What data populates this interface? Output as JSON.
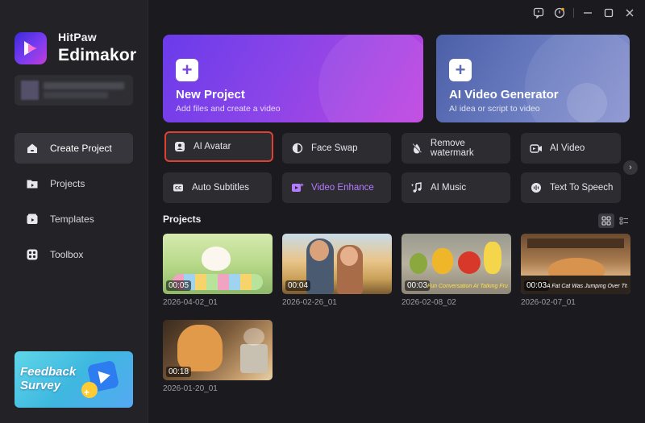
{
  "app": {
    "brand_top": "HitPaw",
    "brand_bottom": "Edimakor"
  },
  "sidebar": {
    "items": [
      {
        "label": "Create Project",
        "icon": "home-icon",
        "active": true
      },
      {
        "label": "Projects",
        "icon": "folder-icon",
        "active": false
      },
      {
        "label": "Templates",
        "icon": "templates-icon",
        "active": false
      },
      {
        "label": "Toolbox",
        "icon": "toolbox-icon",
        "active": false
      }
    ],
    "feedback_banner": "Feedback Survey"
  },
  "window_controls": [
    "feedback-icon",
    "update-icon",
    "minimize-icon",
    "maximize-icon",
    "close-icon"
  ],
  "hero": {
    "new_project": {
      "title": "New Project",
      "subtitle": "Add files and create a video"
    },
    "ai_video_generator": {
      "title": "AI Video Generator",
      "subtitle": "AI idea or script to video"
    }
  },
  "tools": [
    {
      "label": "AI Avatar",
      "icon": "avatar-icon",
      "selected": true
    },
    {
      "label": "Face Swap",
      "icon": "face-swap-icon"
    },
    {
      "label": "Remove watermark",
      "icon": "remove-watermark-icon"
    },
    {
      "label": "AI Video",
      "icon": "ai-video-icon"
    },
    {
      "label": "Auto Subtitles",
      "icon": "subtitles-icon"
    },
    {
      "label": "Video Enhance",
      "icon": "video-enhance-icon",
      "accent": true
    },
    {
      "label": "AI Music",
      "icon": "music-icon"
    },
    {
      "label": "Text To Speech",
      "icon": "speech-icon"
    }
  ],
  "projects": {
    "title": "Projects",
    "items": [
      {
        "name": "2026-04-02_01",
        "duration": "00:05",
        "caption": ""
      },
      {
        "name": "2026-02-26_01",
        "duration": "00:04",
        "caption": ""
      },
      {
        "name": "2026-02-08_02",
        "duration": "00:03",
        "caption": "Fun Conversation AI Talking Fruit Videos"
      },
      {
        "name": "2026-02-07_01",
        "duration": "00:03",
        "caption": "A Fat Cat Was Jumping Over The Lazy Dog"
      },
      {
        "name": "2026-01-20_01",
        "duration": "00:18",
        "caption": ""
      }
    ]
  },
  "colors": {
    "accent_purple": "#8a45e8",
    "selected_border": "#e0402f",
    "enhance_text": "#b47cff"
  }
}
